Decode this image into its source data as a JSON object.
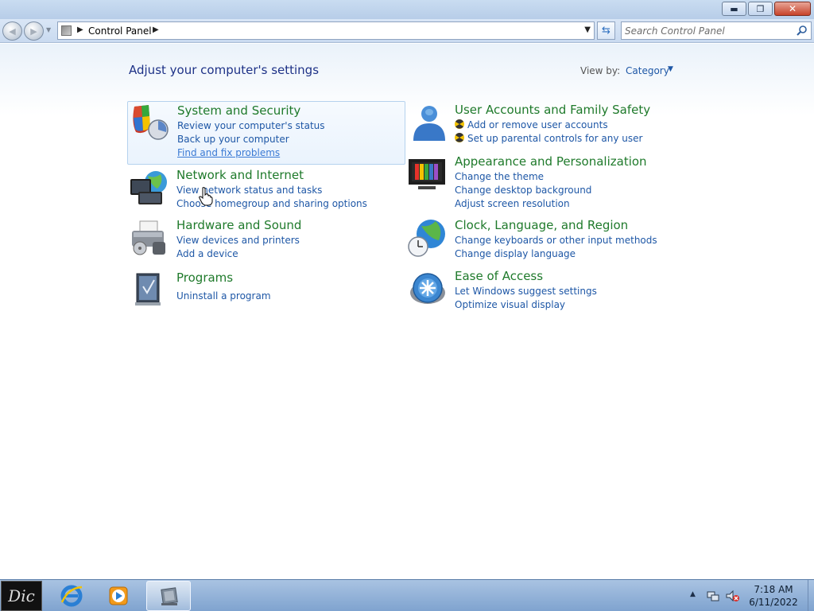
{
  "window": {
    "minimize_glyph": "▬",
    "maximize_glyph": "❐",
    "close_glyph": "✕"
  },
  "nav": {
    "breadcrumb": "Control Panel",
    "search_placeholder": "Search Control Panel"
  },
  "content": {
    "heading": "Adjust your computer's settings",
    "view_by_label": "View by:",
    "view_by_value": "Category"
  },
  "categories": {
    "system_security": {
      "title": "System and Security",
      "links": [
        "Review your computer's status",
        "Back up your computer",
        "Find and fix problems"
      ]
    },
    "network": {
      "title": "Network and Internet",
      "links": [
        "View network status and tasks",
        "Choose homegroup and sharing options"
      ]
    },
    "hardware": {
      "title": "Hardware and Sound",
      "links": [
        "View devices and printers",
        "Add a device"
      ]
    },
    "programs": {
      "title": "Programs",
      "links": [
        "Uninstall a program"
      ]
    },
    "user_accounts": {
      "title": "User Accounts and Family Safety",
      "links": [
        "Add or remove user accounts",
        "Set up parental controls for any user"
      ]
    },
    "appearance": {
      "title": "Appearance and Personalization",
      "links": [
        "Change the theme",
        "Change desktop background",
        "Adjust screen resolution"
      ]
    },
    "clock": {
      "title": "Clock, Language, and Region",
      "links": [
        "Change keyboards or other input methods",
        "Change display language"
      ]
    },
    "ease": {
      "title": "Ease of Access",
      "links": [
        "Let Windows suggest settings",
        "Optimize visual display"
      ]
    }
  },
  "taskbar": {
    "start_label": "Dic",
    "time": "7:18 AM",
    "date": "6/11/2022"
  },
  "colors": {
    "link": "#1e57a6",
    "category_title": "#1f7a2b",
    "heading": "#1e3287"
  }
}
